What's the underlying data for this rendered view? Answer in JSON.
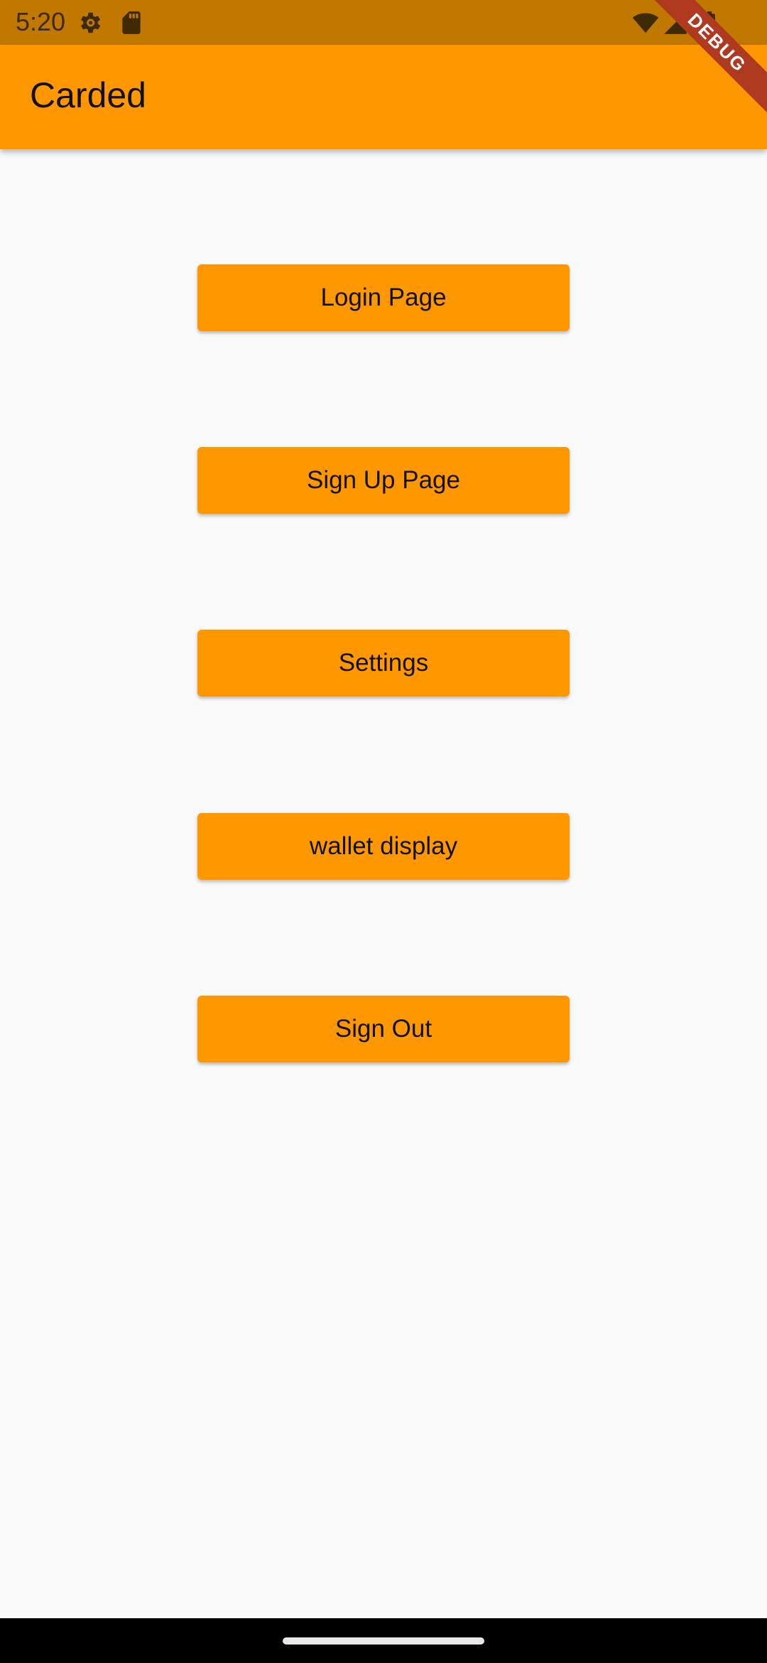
{
  "status_bar": {
    "time": "5:20",
    "icons": [
      "settings-gear-icon",
      "sd-card-icon",
      "wifi-icon",
      "cell-signal-icon",
      "battery-icon"
    ]
  },
  "app_bar": {
    "title": "Carded"
  },
  "menu": {
    "buttons": [
      {
        "label": "Login Page"
      },
      {
        "label": "Sign Up Page"
      },
      {
        "label": "Settings"
      },
      {
        "label": "wallet display"
      },
      {
        "label": "Sign Out"
      }
    ]
  },
  "debug_banner": {
    "label": "DEBUG"
  },
  "colors": {
    "status_bar": "#C07800",
    "app_bar": "#FF9800",
    "button": "#FF9800",
    "background": "#FAFAFA",
    "debug_banner": "#B03A1F",
    "nav_bar": "#000000"
  }
}
